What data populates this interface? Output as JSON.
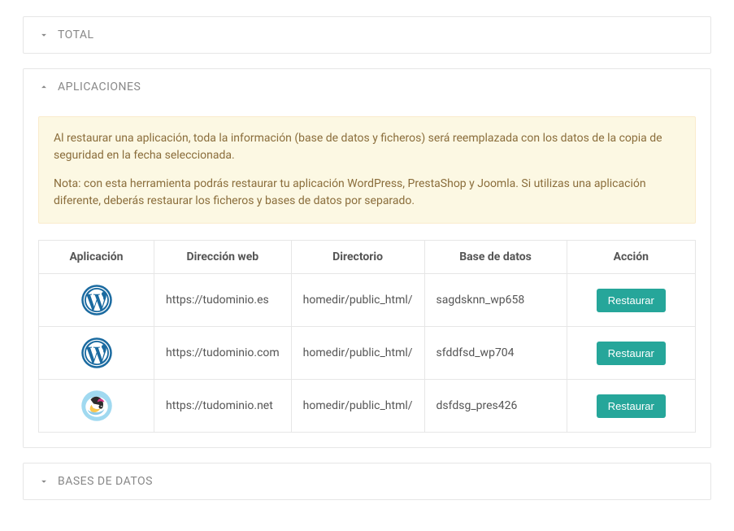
{
  "panels": {
    "total": {
      "title": "TOTAL"
    },
    "applications": {
      "title": "APLICACIONES",
      "alert_p1": "Al restaurar una aplicación, toda la información (base de datos y ficheros) será reemplazada con los datos de la copia de seguridad en la fecha seleccionada.",
      "alert_p2": "Nota: con esta herramienta podrás restaurar tu aplicación WordPress, PrestaShop y Joomla. Si utilizas una aplicación diferente, deberás restaurar los ficheros y bases de datos por separado.",
      "table": {
        "headers": {
          "app": "Aplicación",
          "url": "Dirección web",
          "dir": "Directorio",
          "db": "Base de datos",
          "action": "Acción"
        },
        "rows": [
          {
            "app_icon": "wordpress",
            "url": "https://tudominio.es",
            "dir": "homedir/public_html/",
            "db": "sagdsknn_wp658",
            "action_label": "Restaurar"
          },
          {
            "app_icon": "wordpress",
            "url": "https://tudominio.com",
            "dir": "homedir/public_html/",
            "db": "sfddfsd_wp704",
            "action_label": "Restaurar"
          },
          {
            "app_icon": "prestashop",
            "url": "https://tudominio.net",
            "dir": "homedir/public_html/",
            "db": "dsfdsg_pres426",
            "action_label": "Restaurar"
          }
        ]
      }
    },
    "databases": {
      "title": "BASES DE DATOS"
    }
  }
}
